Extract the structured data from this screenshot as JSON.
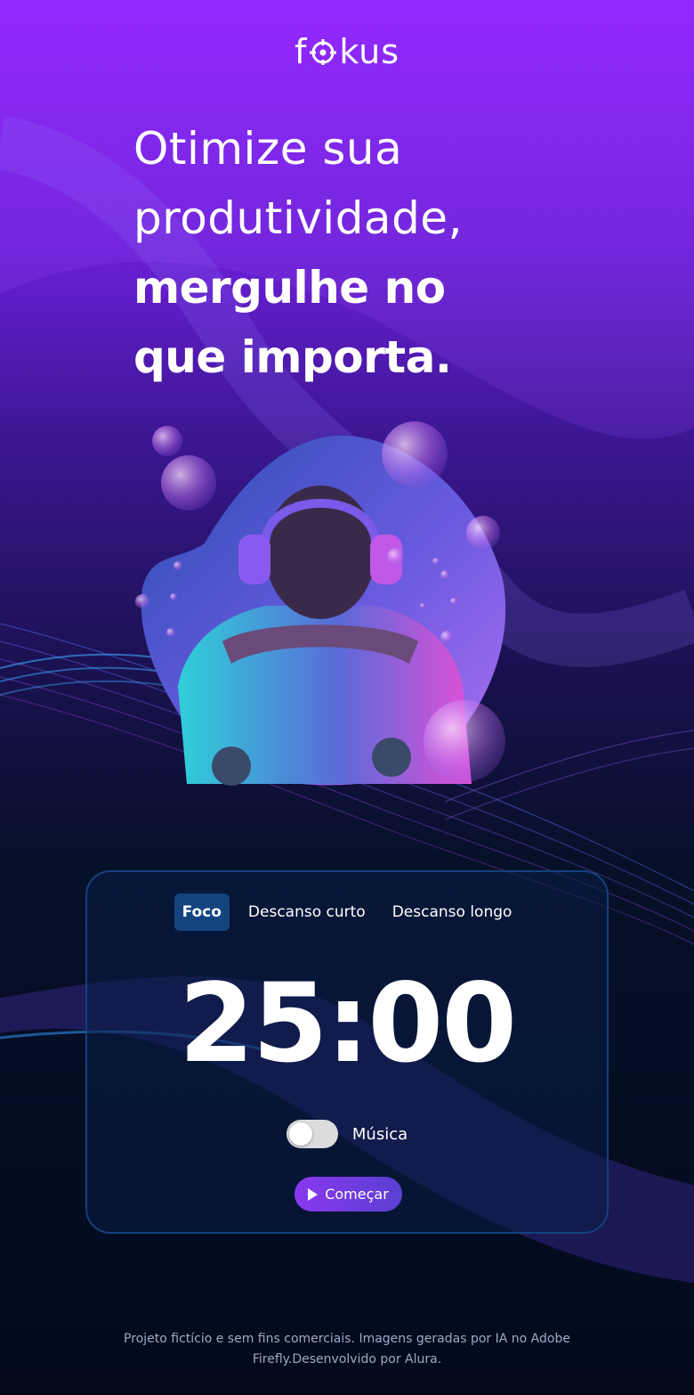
{
  "brand": {
    "logo_start": "f",
    "logo_end": "kus",
    "accent": "#8a38ee",
    "tab_active_bg": "#144480"
  },
  "hero": {
    "line1": "Otimize sua",
    "line2": "produtividade,",
    "line3": "mergulhe no",
    "line4": "que importa."
  },
  "timer": {
    "tabs": [
      {
        "label": "Foco",
        "active": true
      },
      {
        "label": "Descanso curto",
        "active": false
      },
      {
        "label": "Descanso longo",
        "active": false
      }
    ],
    "time": "25:00",
    "music_label": "Música",
    "music_on": false,
    "start_label": "Começar"
  },
  "footer": {
    "line1": "Projeto fictício e sem fins comerciais. Imagens geradas por IA no Adobe",
    "line2": "Firefly.Desenvolvido por Alura."
  }
}
